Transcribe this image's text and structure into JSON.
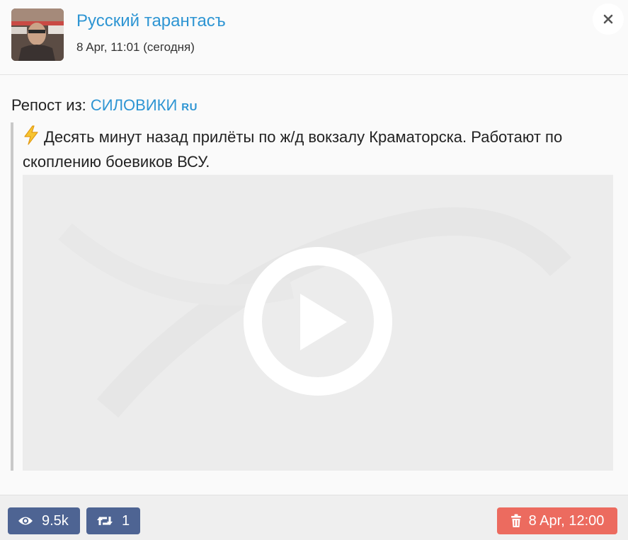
{
  "header": {
    "channel_name": "Русский тарантасъ",
    "post_date": "8 Apr, 11:01 (сегодня)",
    "close_icon": "close-icon"
  },
  "post": {
    "repost_prefix": "Репост из:",
    "repost_source": "СИЛОВИКИ",
    "repost_flag": "RU",
    "emoji_icon": "lightning-icon",
    "text": "Десять минут назад прилёты по ж/д вокзалу Краматорска. Работают по скоплению боевиков ВСУ.",
    "video": {
      "play_icon": "play-icon"
    }
  },
  "footer": {
    "views": "9.5k",
    "views_icon": "eye-icon",
    "reposts": "1",
    "reposts_icon": "repost-icon",
    "deleted_at": "8 Apr, 12:00",
    "deleted_icon": "trash-icon"
  },
  "colors": {
    "link": "#2e95d3",
    "stat_button": "#4e6493",
    "delete_button": "#ec6b5f"
  }
}
